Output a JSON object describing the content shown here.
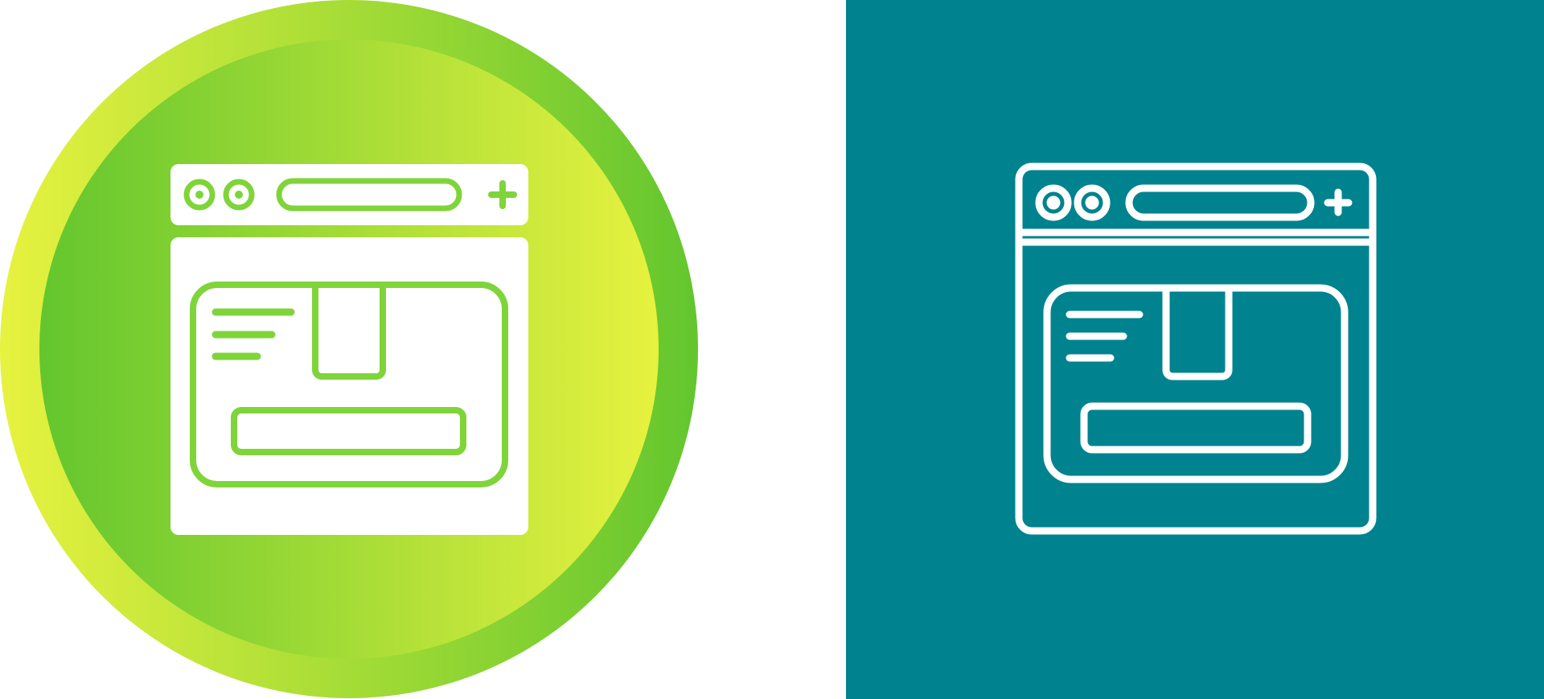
{
  "icons": {
    "left": {
      "name": "browser-box-glyph-icon",
      "outer_gradient": [
        "#e7f23f",
        "#63c62e"
      ],
      "inner_gradient": [
        "#63c62e",
        "#e7f23f"
      ],
      "glyph_color": "#ffffff",
      "detail_color": "#7fd43a"
    },
    "right": {
      "name": "browser-box-outline-icon",
      "background_color": "#00838f",
      "stroke_color": "#ffffff"
    }
  }
}
